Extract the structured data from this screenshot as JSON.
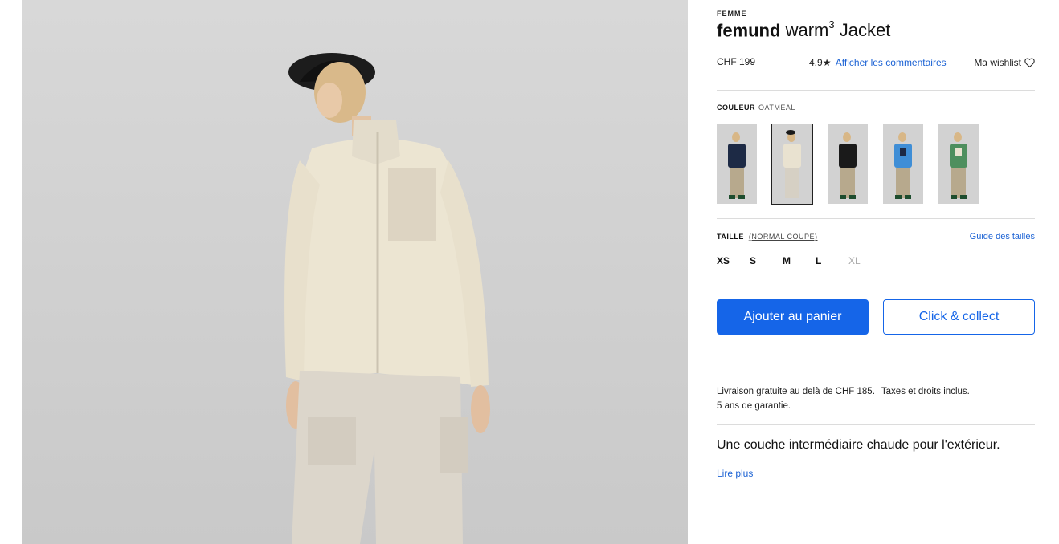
{
  "product": {
    "category": "FEMME",
    "brand": "femund",
    "model": "warm",
    "model_superscript": "3",
    "model_suffix": "Jacket",
    "price": "CHF 199",
    "rating": "4.9",
    "reviews_link": "Afficher les commentaires",
    "wishlist_label": "Ma wishlist"
  },
  "color": {
    "label": "COULEUR",
    "selected": "OATMEAL",
    "swatches": [
      {
        "name": "navy",
        "jacket": "#1d2a45"
      },
      {
        "name": "oatmeal",
        "jacket": "#e9e2d0"
      },
      {
        "name": "black",
        "jacket": "#1a1a1a"
      },
      {
        "name": "blue",
        "jacket": "#3f8ed6"
      },
      {
        "name": "green",
        "jacket": "#4e8f5e"
      }
    ]
  },
  "size": {
    "label": "TAILLE",
    "fit": "(NORMAL COUPE)",
    "guide": "Guide des tailles",
    "options": [
      "XS",
      "S",
      "M",
      "L",
      "XL"
    ]
  },
  "actions": {
    "add_to_cart": "Ajouter au panier",
    "click_collect": "Click & collect"
  },
  "shipping": {
    "free_delivery": "Livraison gratuite au delà de CHF 185.",
    "taxes": "Taxes et droits inclus.",
    "warranty": "5 ans de garantie."
  },
  "description": {
    "text": "Une couche intermédiaire chaude pour l'extérieur.",
    "read_more": "Lire plus"
  },
  "colors": {
    "accent": "#1565e8",
    "link": "#1b62d4"
  }
}
